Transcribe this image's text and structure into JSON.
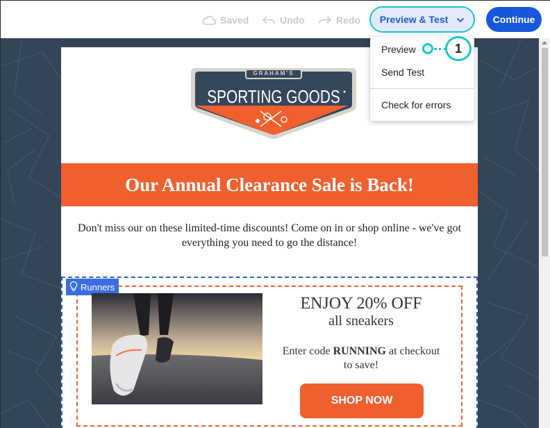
{
  "toolbar": {
    "saved_label": "Saved",
    "undo_label": "Undo",
    "redo_label": "Redo",
    "preview_test_label": "Preview & Test",
    "continue_label": "Continue"
  },
  "dropdown": {
    "items": [
      "Preview",
      "Send Test",
      "Check for errors"
    ]
  },
  "callout": {
    "number": "1"
  },
  "email": {
    "logo": {
      "top_text": "GRAHAM'S",
      "main_text": "SPORTING GOODS"
    },
    "banner_title": "Our Annual Clearance Sale is Back!",
    "intro_text": "Don't miss our on these limited-time discounts! Come on in or shop online - we've got everything you need to go the distance!",
    "promo": {
      "tag_label": "Runners",
      "offer_title": "ENJOY 20% OFF",
      "offer_subtitle": "all sneakers",
      "code_prefix": "Enter code ",
      "code": "RUNNING",
      "code_suffix": " at checkout to save!",
      "button_label": "SHOP NOW"
    }
  },
  "colors": {
    "accent_teal": "#19c7c9",
    "brand_blue": "#1857d9",
    "orange": "#f0602f",
    "canvas_bg": "#344558"
  }
}
